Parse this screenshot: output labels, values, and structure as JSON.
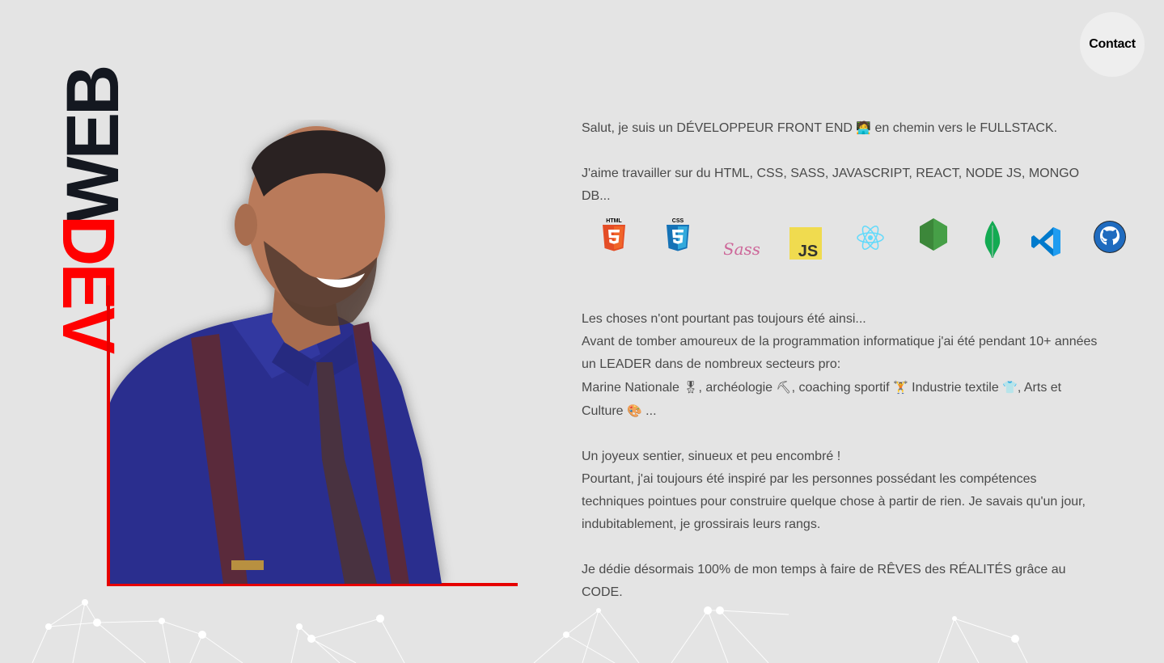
{
  "nav": {
    "contact_label": "Contact"
  },
  "logo": {
    "word_top": "WEB",
    "word_bottom": "DEV"
  },
  "colors": {
    "background": "#e4e4e4",
    "accent": "#e60000",
    "logo_dark": "#141820",
    "text": "#4a4a4a"
  },
  "intro": {
    "line1_before": "Salut, je suis un DÉVELOPPEUR FRONT END",
    "line1_emoji": "🧑‍💻",
    "line1_after": "en chemin vers le FULLSTACK."
  },
  "stack_text": "J'aime travailler sur du HTML, CSS, SASS, JAVASCRIPT, REACT, NODE JS, MONGO DB...",
  "tech_icons": [
    {
      "name": "html5-icon",
      "label": "HTML"
    },
    {
      "name": "css3-icon",
      "label": "CSS"
    },
    {
      "name": "sass-icon",
      "label": "Sass"
    },
    {
      "name": "javascript-icon",
      "label": "JS"
    },
    {
      "name": "react-icon",
      "label": ""
    },
    {
      "name": "nodejs-icon",
      "label": ""
    },
    {
      "name": "mongodb-icon",
      "label": ""
    },
    {
      "name": "vscode-icon",
      "label": ""
    },
    {
      "name": "github-icon",
      "label": ""
    }
  ],
  "story": {
    "line1": "Les choses n'ont pourtant pas toujours été ainsi...",
    "line2": "Avant de tomber amoureux de la programmation informatique j'ai été pendant 10+ années un LEADER dans de nombreux secteurs pro:",
    "line3_parts": {
      "a": "Marine Nationale",
      "a_emoji": "🎖",
      "b": ", archéologie",
      "b_emoji": "⛏",
      "c": ", coaching sportif",
      "c_emoji": "🏋",
      "d": "Industrie textile",
      "d_emoji": "👕",
      "e": ", Arts et Culture",
      "e_emoji": "🎨",
      "f": "..."
    }
  },
  "path": {
    "line1": "Un joyeux sentier, sinueux et peu encombré !",
    "line2": "Pourtant, j'ai toujours été inspiré par les personnes possédant les compétences techniques pointues pour construire quelque chose à partir de rien. Je savais qu'un jour, indubitablement, je grossirais leurs rangs."
  },
  "closing": "Je dédie désormais 100% de mon temps à faire de RÊVES des RÉALITÉS grâce au CODE."
}
